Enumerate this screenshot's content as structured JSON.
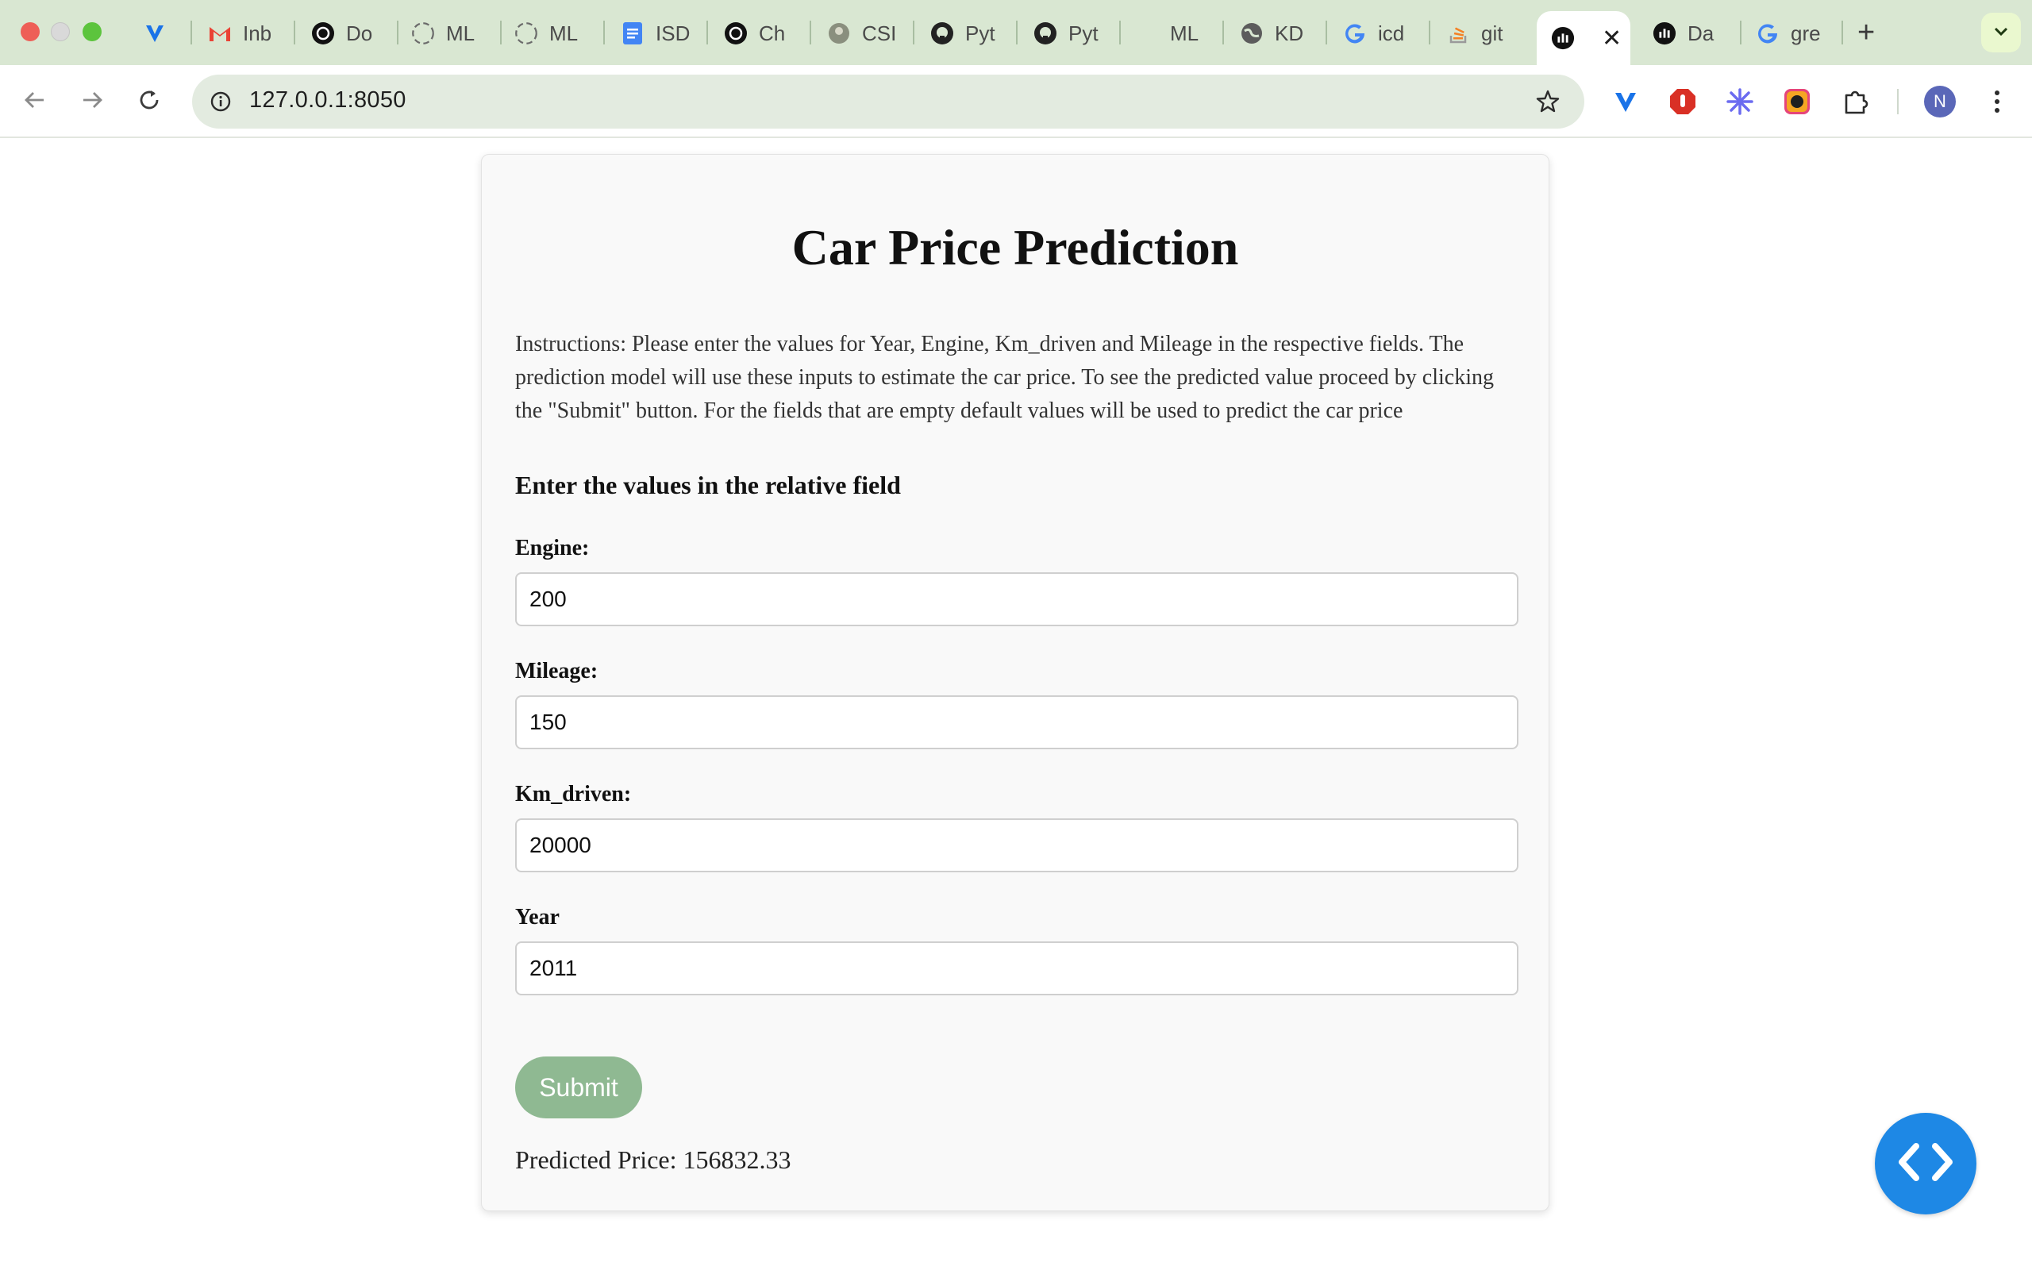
{
  "browser": {
    "tabs": [
      {
        "label": "",
        "icon": "yoast-icon"
      },
      {
        "label": "Inb",
        "icon": "gmail-icon"
      },
      {
        "label": "Do",
        "icon": "openai-icon"
      },
      {
        "label": "ML",
        "icon": "loading-icon"
      },
      {
        "label": "ML",
        "icon": "loading-icon"
      },
      {
        "label": "ISD",
        "icon": "docs-icon"
      },
      {
        "label": "Ch",
        "icon": "openai-icon"
      },
      {
        "label": "CSI",
        "icon": "image-icon"
      },
      {
        "label": "Pyt",
        "icon": "github-icon"
      },
      {
        "label": "Pyt",
        "icon": "github-icon"
      },
      {
        "label": "ML",
        "icon": "blank-icon"
      },
      {
        "label": "KD",
        "icon": "globe-icon"
      },
      {
        "label": "icd",
        "icon": "google-icon"
      },
      {
        "label": "git",
        "icon": "stackoverflow-icon"
      },
      {
        "label": "",
        "icon": "dash-icon",
        "active": true
      },
      {
        "label": "Da",
        "icon": "dash-icon"
      },
      {
        "label": "gre",
        "icon": "google-icon"
      }
    ],
    "url": "127.0.0.1:8050",
    "avatar_initial": "N"
  },
  "page": {
    "title": "Car Price Prediction",
    "instructions": "Instructions: Please enter the values for Year, Engine, Km_driven and Mileage in the respective fields. The prediction model will use these inputs to estimate the car price. To see the predicted value proceed by clicking the \"Submit\" button. For the fields that are empty default values will be used to predict the car price",
    "form_heading": "Enter the values in the relative field",
    "fields": [
      {
        "label": "Engine:",
        "value": "200"
      },
      {
        "label": "Mileage:",
        "value": "150"
      },
      {
        "label": "Km_driven:",
        "value": "20000"
      },
      {
        "label": "Year",
        "value": "2011"
      }
    ],
    "submit_label": "Submit",
    "result_label": "Predicted Price:",
    "result_value": "156832.33"
  },
  "colors": {
    "tabstrip": "#d9e7d2",
    "submit": "#8fb992",
    "fab": "#1e88e5"
  }
}
